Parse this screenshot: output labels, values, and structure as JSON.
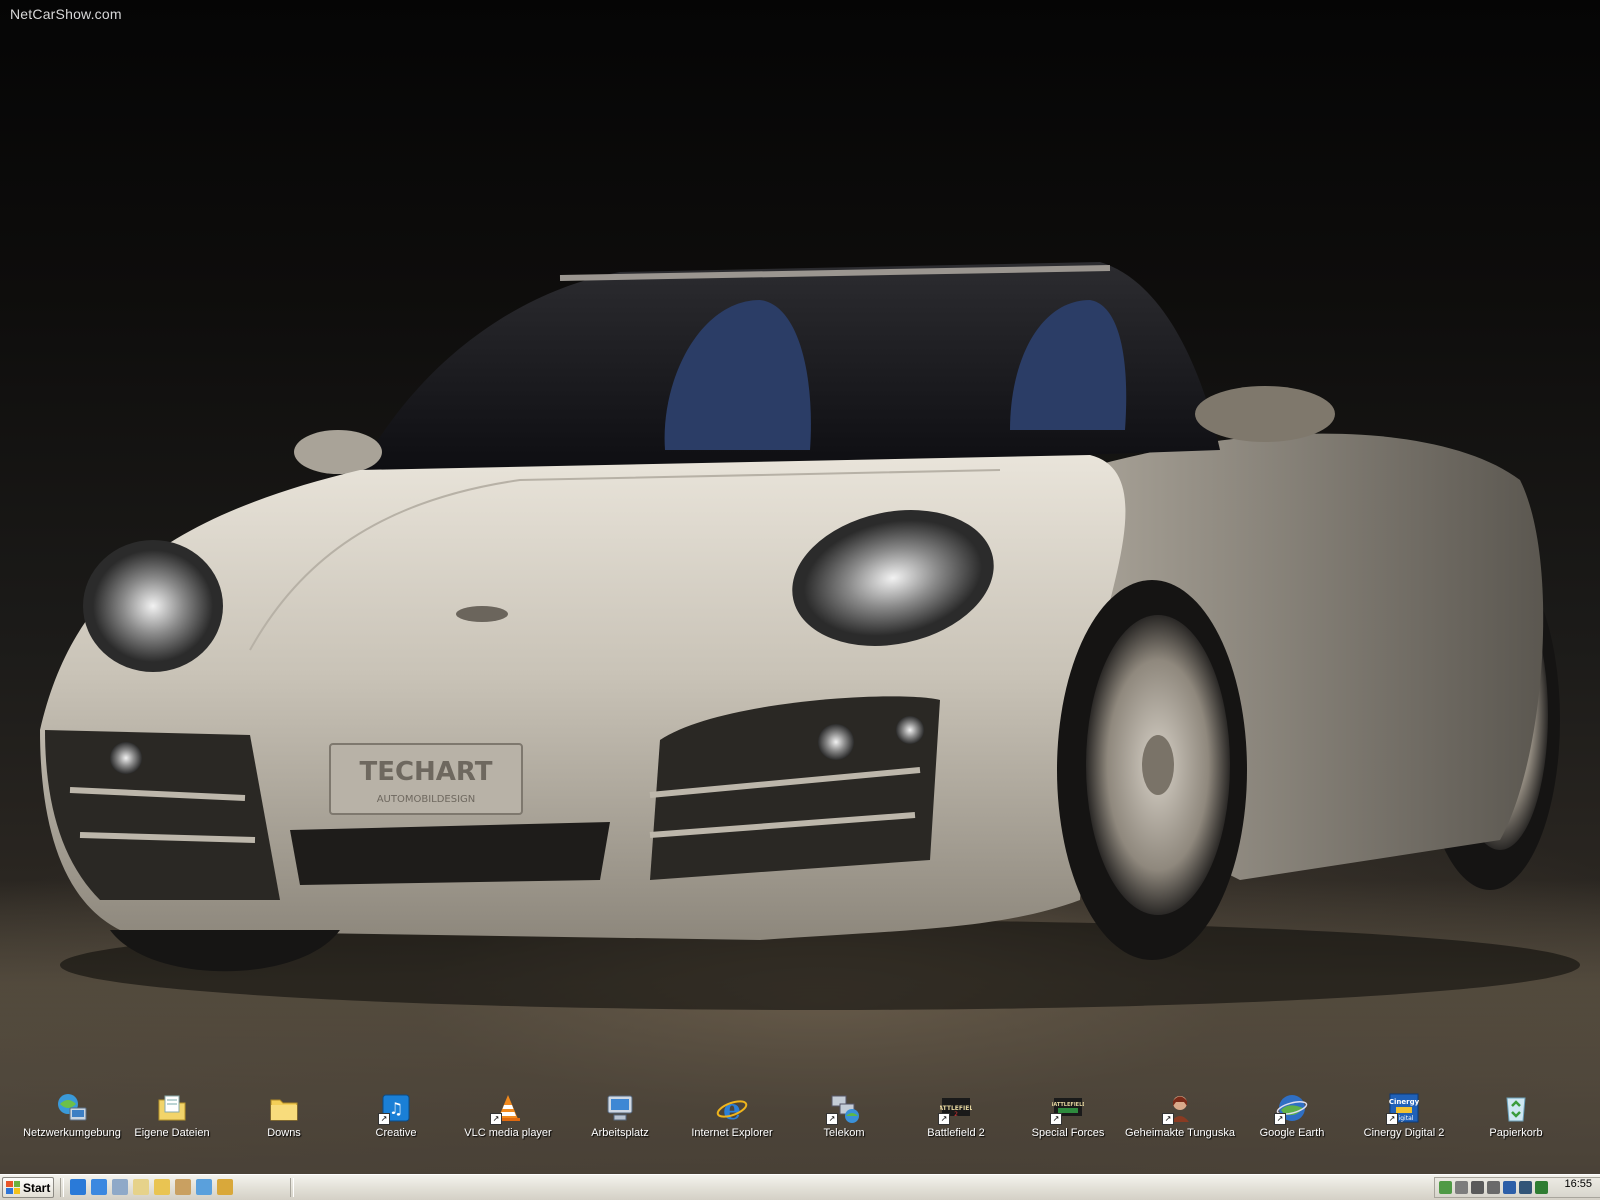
{
  "wallpaper": {
    "watermark": "NetCarShow.com",
    "plate_text": "TECHART",
    "plate_subtext": "AUTOMOBILDESIGN"
  },
  "desktop_icons": [
    {
      "label": "Netzwerkumgebung",
      "icon": "network-places-icon",
      "shortcut": false
    },
    {
      "label": "Eigene Dateien",
      "icon": "my-documents-icon",
      "shortcut": false
    },
    {
      "label": "Downs",
      "icon": "folder-icon",
      "shortcut": false
    },
    {
      "label": "Creative",
      "icon": "creative-app-icon",
      "shortcut": true
    },
    {
      "label": "VLC media player",
      "icon": "vlc-cone-icon",
      "shortcut": true
    },
    {
      "label": "Arbeitsplatz",
      "icon": "my-computer-icon",
      "shortcut": false
    },
    {
      "label": "Internet Explorer",
      "icon": "internet-explorer-icon",
      "shortcut": false
    },
    {
      "label": "Telekom",
      "icon": "telekom-network-icon",
      "shortcut": true
    },
    {
      "label": "Battlefield 2",
      "icon": "battlefield-icon",
      "shortcut": true
    },
    {
      "label": "Special Forces",
      "icon": "battlefield-special-forces-icon",
      "shortcut": true
    },
    {
      "label": "Geheimakte Tunguska",
      "icon": "game-character-icon",
      "shortcut": true
    },
    {
      "label": "Google Earth",
      "icon": "google-earth-icon",
      "shortcut": true
    },
    {
      "label": "Cinergy Digital 2",
      "icon": "cinergy-tv-icon",
      "shortcut": true
    },
    {
      "label": "Papierkorb",
      "icon": "recycle-bin-icon",
      "shortcut": false
    }
  ],
  "taskbar": {
    "start_label": "Start",
    "quick_launch": [
      {
        "icon": "ie-quicklaunch-icon",
        "color": "#2a7ad8"
      },
      {
        "icon": "ie-alt-quicklaunch-icon",
        "color": "#3b88e0"
      },
      {
        "icon": "notepad-quicklaunch-icon",
        "color": "#8fa9c8"
      },
      {
        "icon": "show-desktop-icon",
        "color": "#e6d28a"
      },
      {
        "icon": "folder-quicklaunch-icon",
        "color": "#e9c452"
      },
      {
        "icon": "brush-quicklaunch-icon",
        "color": "#c9a061"
      },
      {
        "icon": "messenger-quicklaunch-icon",
        "color": "#5aa0dc"
      },
      {
        "icon": "media-quicklaunch-icon",
        "color": "#d9a83a"
      }
    ],
    "tray_icons": [
      {
        "icon": "network-tray-icon",
        "color": "#4f9a45"
      },
      {
        "icon": "antivirus-tray-icon",
        "color": "#7d7d7d"
      },
      {
        "icon": "volume-tray-icon",
        "color": "#5a5a5a"
      },
      {
        "icon": "connection-tray-icon",
        "color": "#6a6a6a"
      },
      {
        "icon": "globe-tray-icon",
        "color": "#2d5fa8"
      },
      {
        "icon": "display-tray-icon",
        "color": "#335577"
      },
      {
        "icon": "cpu-tray-icon",
        "color": "#2f7d32"
      }
    ],
    "clock": "16:55"
  }
}
